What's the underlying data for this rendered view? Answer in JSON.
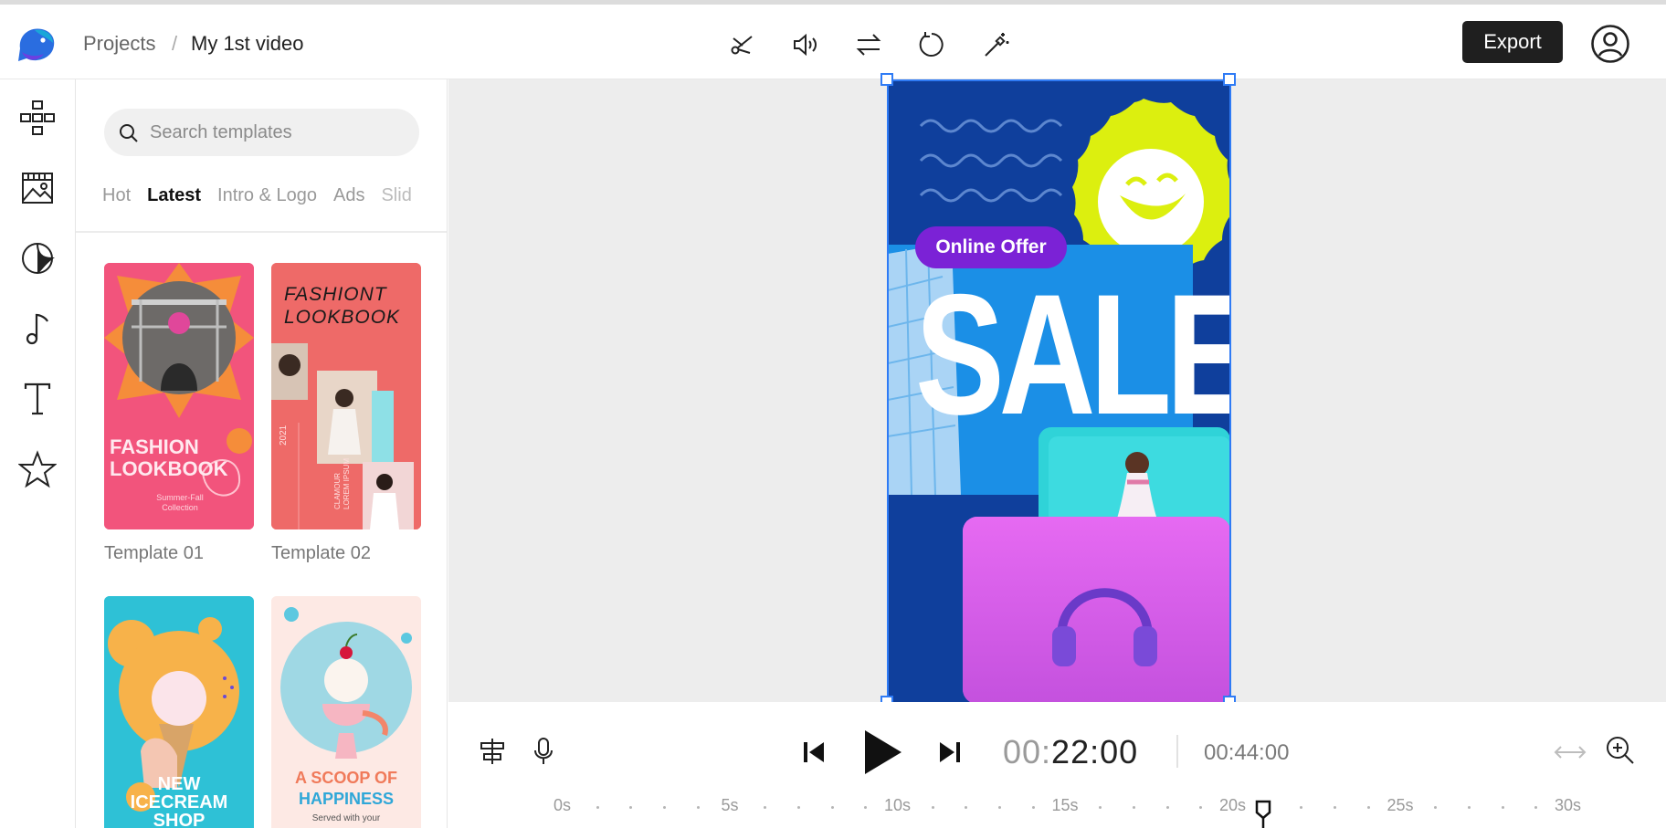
{
  "header": {
    "breadcrumb_root": "Projects",
    "breadcrumb_separator": "/",
    "breadcrumb_current": "My 1st video",
    "export_label": "Export",
    "tools": [
      "scissors-icon",
      "volume-icon",
      "swap-icon",
      "rotate-icon",
      "magic-wand-icon"
    ]
  },
  "rail": [
    "layout-icon",
    "media-icon",
    "sticker-icon",
    "music-icon",
    "text-icon",
    "star-icon"
  ],
  "panel": {
    "search_placeholder": "Search templates",
    "tabs": [
      "Hot",
      "Latest",
      "Intro & Logo",
      "Ads",
      "Slid"
    ],
    "active_tab": "Latest",
    "templates": [
      {
        "label": "Template 01",
        "title_line1": "FASHION",
        "title_line2": "LOOKBOOK",
        "sub": "Summer-Fall Collection"
      },
      {
        "label": "Template 02",
        "title_line1": "FASHIONT",
        "title_line2": "LOOKBOOK",
        "side_year": "2021",
        "side_text": "CLAMOUR LOREM IPSUM"
      },
      {
        "label": "",
        "title_line1": "NEW",
        "title_line2": "ICECREAM",
        "title_line3": "SHOP"
      },
      {
        "label": "",
        "title_line1": "A SCOOP OF",
        "title_line2": "HAPPINESS",
        "sub": "Served with your"
      }
    ]
  },
  "canvas": {
    "badge": "Online Offer",
    "headline": "SALE"
  },
  "playback": {
    "current_dim": "00:",
    "current_main": "22:00",
    "total": "00:44:00",
    "ruler_labels": [
      "0s",
      "5s",
      "10s",
      "15s",
      "20s",
      "25s",
      "30s"
    ]
  },
  "colors": {
    "accent": "#2f7bf5",
    "canvas_bg": "#0f3f9c",
    "badge": "#7b22d6",
    "sun": "#dcef0f"
  }
}
